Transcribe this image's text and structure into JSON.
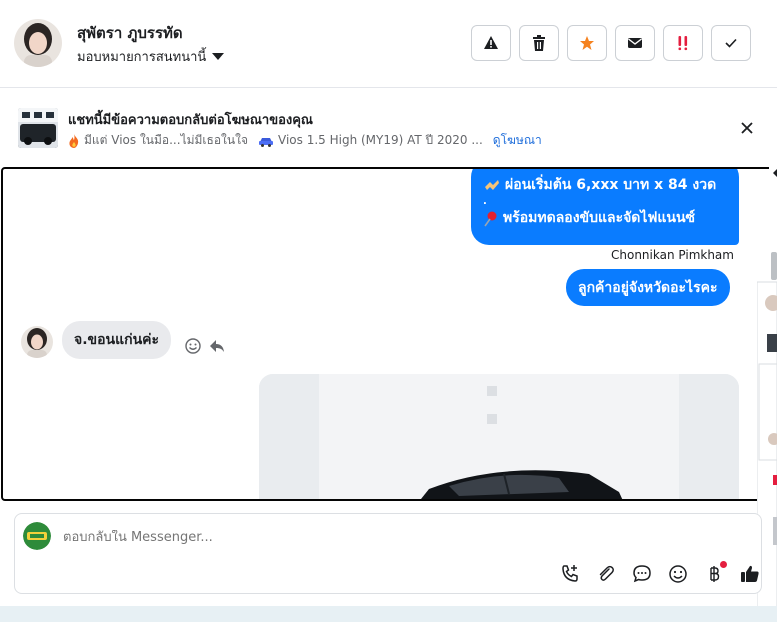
{
  "header": {
    "name": "สุพัตรา ภูบรรทัด",
    "assign_label": "มอบหมายการสนทนานี้"
  },
  "ad_banner": {
    "title": "แชทนี้มีข้อความตอบกลับต่อโฆษณาของคุณ",
    "ad_text": "มีแต่ Vios ในมือ...ไม่มีเธอในใจ",
    "car_text": "Vios 1.5 High (MY19) AT ปี 2020 ...",
    "view_ad_link": "ดูโฆษณา"
  },
  "messages": {
    "outgoing_1_line1": "ผ่อนเริ่มต้น 6,xxx บาท x 84 งวด",
    "outgoing_1_line2": ".",
    "outgoing_1_line3": "พร้อมทดลองขับและจัดไฟแนนซ์",
    "sender_name": "Chonnikan Pimkham",
    "outgoing_2": "ลูกค้าอยู่จังหวัดอะไรคะ",
    "incoming_1": "จ.ขอนแก่นค่ะ"
  },
  "composer": {
    "placeholder": "ตอบกลับใน Messenger..."
  },
  "colors": {
    "outgoing_bubble": "#0a7cff",
    "incoming_bubble": "#e9eaed",
    "link": "#216fdb",
    "star": "#f5821f",
    "urgent": "#e41e3f"
  },
  "icons": {
    "actions": [
      "warning-icon",
      "trash-icon",
      "star-icon",
      "envelope-icon",
      "urgent-icon",
      "check-icon"
    ],
    "composer": [
      "call-icon",
      "attachment-icon",
      "saved-reply-icon",
      "emoji-icon",
      "baht-icon",
      "like-icon"
    ]
  }
}
